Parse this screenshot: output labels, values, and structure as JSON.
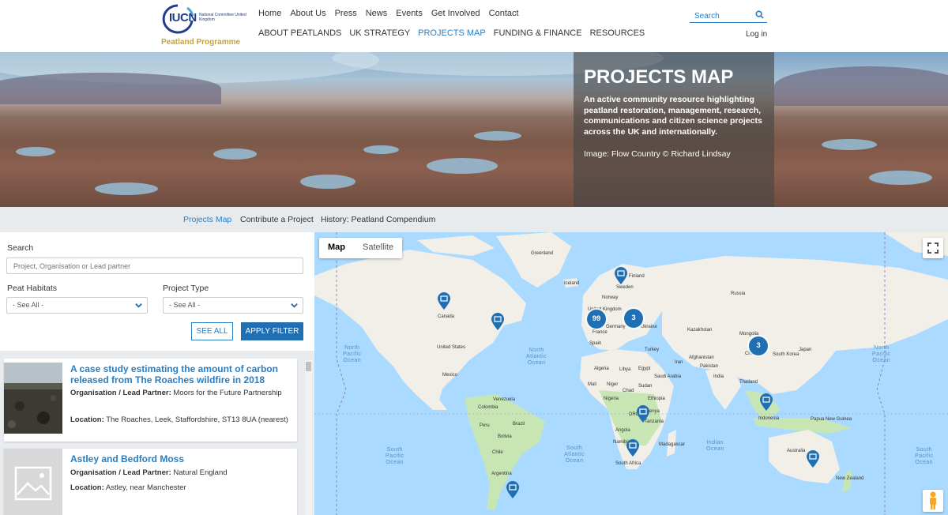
{
  "logo": {
    "org": "IUCN",
    "subtitle": "National Committee United Kingdom",
    "programme": "Peatland Programme",
    "brand_blue": "#1f3c88",
    "brand_gold": "#c8a23c"
  },
  "nav": {
    "top": [
      "Home",
      "About Us",
      "Press",
      "News",
      "Events",
      "Get Involved",
      "Contact"
    ],
    "main": [
      "ABOUT PEATLANDS",
      "UK STRATEGY",
      "PROJECTS MAP",
      "FUNDING & FINANCE",
      "RESOURCES"
    ],
    "active": "PROJECTS MAP",
    "search_placeholder": "Search",
    "login": "Log in"
  },
  "hero": {
    "title": "PROJECTS MAP",
    "description": "An active community resource highlighting peatland restoration, management, research, communications and citizen science projects across the UK and internationally.",
    "credit": "Image: Flow Country © Richard Lindsay"
  },
  "subnav": [
    "Projects Map",
    "Contribute a Project",
    "History: Peatland Compendium"
  ],
  "filter": {
    "search_label": "Search",
    "search_placeholder": "Project, Organisation or Lead partner",
    "habitats_label": "Peat Habitats",
    "habitats_value": "- See All -",
    "type_label": "Project Type",
    "type_value": "- See All -",
    "see_all": "SEE ALL",
    "apply": "APPLY FILTER"
  },
  "results": [
    {
      "title": "A case study estimating the amount of carbon released from The Roaches wildfire in 2018",
      "org_label": "Organisation / Lead Partner:",
      "org": "Moors for the Future Partnership",
      "loc_label": "Location:",
      "location": "The Roaches, Leek, Staffordshire, ST13 8UA (nearest)"
    },
    {
      "title": "Astley and Bedford Moss",
      "org_label": "Organisation / Lead Partner:",
      "org": "Natural England",
      "loc_label": "Location:",
      "location": "Astley, near Manchester"
    }
  ],
  "map": {
    "toggle_map": "Map",
    "toggle_satellite": "Satellite",
    "clusters": [
      "99",
      "3",
      "3"
    ],
    "countries": [
      "Greenland",
      "Iceland",
      "Finland",
      "Norway",
      "Sweden",
      "Russia",
      "Canada",
      "United States",
      "Mexico",
      "Kazakhstan",
      "Mongolia",
      "China",
      "Japan",
      "South Korea",
      "Turkey",
      "Iran",
      "Afghanistan",
      "Pakistan",
      "India",
      "Thailand",
      "Algeria",
      "Libya",
      "Egypt",
      "Saudi Arabia",
      "Mali",
      "Niger",
      "Chad",
      "Sudan",
      "Nigeria",
      "Ethiopia",
      "DRC",
      "Kenya",
      "Tanzania",
      "Angola",
      "Namibia",
      "Madagascar",
      "South Africa",
      "Venezuela",
      "Colombia",
      "Peru",
      "Brazil",
      "Bolivia",
      "Chile",
      "Argentina",
      "Spain",
      "France",
      "Germany",
      "Ukraine",
      "United Kingdom",
      "Indonesia",
      "Papua New Guinea",
      "Australia",
      "New Zealand"
    ],
    "oceans": [
      "North Pacific Ocean",
      "North Atlantic Ocean",
      "South Pacific Ocean",
      "South Atlantic Ocean",
      "Indian Ocean",
      "North Pacific Ocean",
      "South Pacific Ocean"
    ],
    "colors": {
      "water": "#aadaff",
      "land": "#f2efe9",
      "land_green": "#c8e6b4",
      "pin": "#1f6fb2"
    }
  }
}
